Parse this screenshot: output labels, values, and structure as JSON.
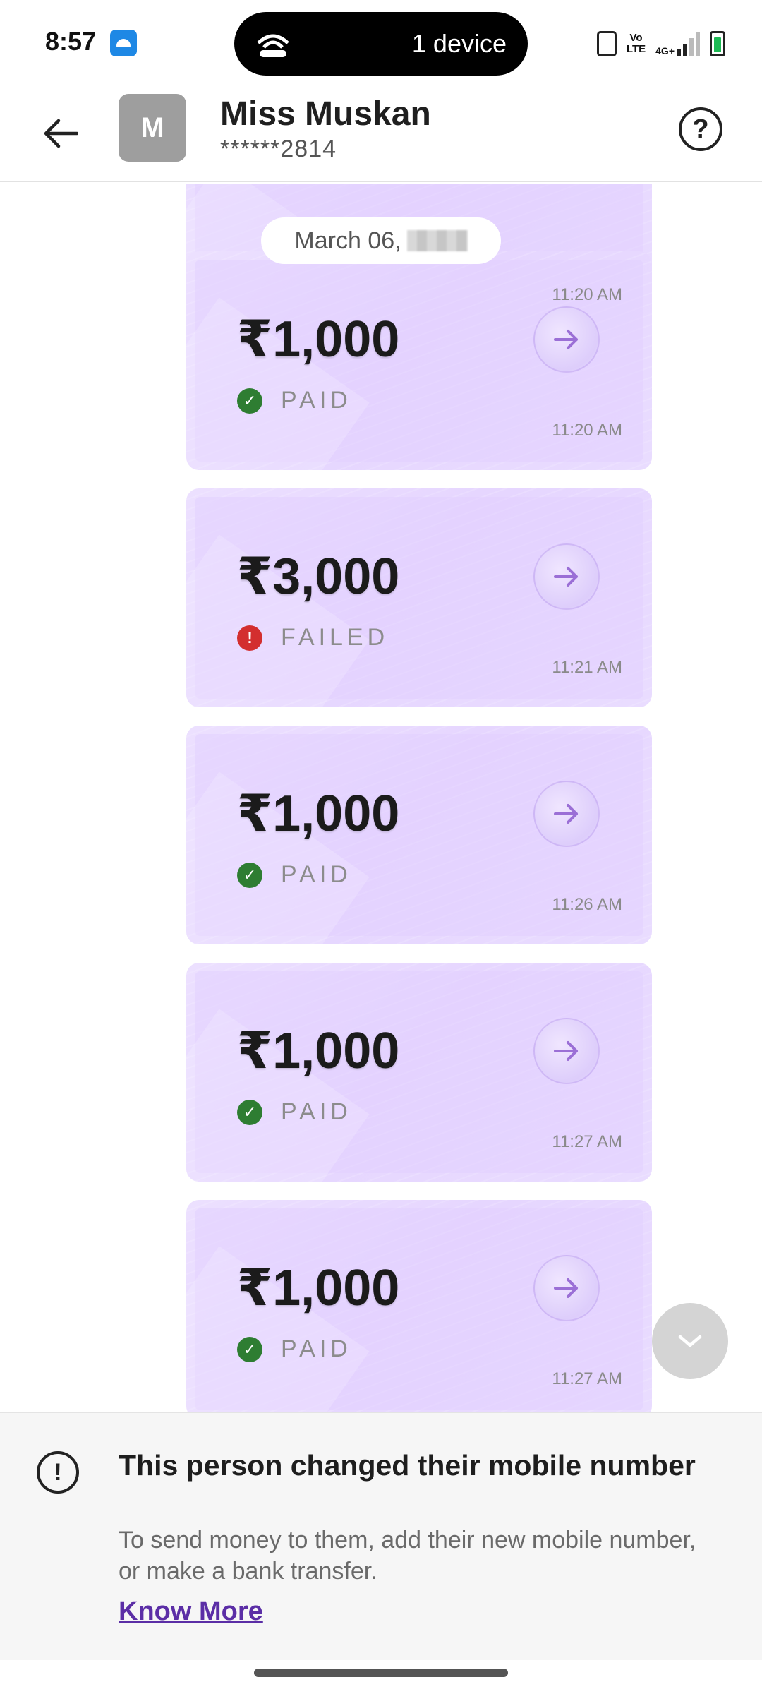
{
  "status_bar": {
    "time": "8:57",
    "pill_text": "1 device",
    "volte_line1": "Vo",
    "volte_line2": "LTE",
    "network": "4G+"
  },
  "header": {
    "avatar_letter": "M",
    "name": "Miss Muskan",
    "number": "******2814",
    "help": "?"
  },
  "chat": {
    "top_card_time": "11:20 AM",
    "date_label": "March 06,",
    "payments": [
      {
        "amount": "₹1,000",
        "status": "PAID",
        "time": "11:20 AM"
      },
      {
        "amount": "₹3,000",
        "status": "FAILED",
        "time": "11:21 AM"
      },
      {
        "amount": "₹1,000",
        "status": "PAID",
        "time": "11:26 AM"
      },
      {
        "amount": "₹1,000",
        "status": "PAID",
        "time": "11:27 AM"
      },
      {
        "amount": "₹1,000",
        "status": "PAID",
        "time": "11:27 AM"
      }
    ]
  },
  "notice": {
    "title": "This person changed their mobile number",
    "body": "To send money to them, add their new mobile number, or make a bank transfer.",
    "link": "Know More",
    "icon": "!"
  },
  "colors": {
    "paid": "#2e7d32",
    "failed": "#d32f2f",
    "card": "#e6d6ff",
    "link": "#5b2ea6"
  }
}
